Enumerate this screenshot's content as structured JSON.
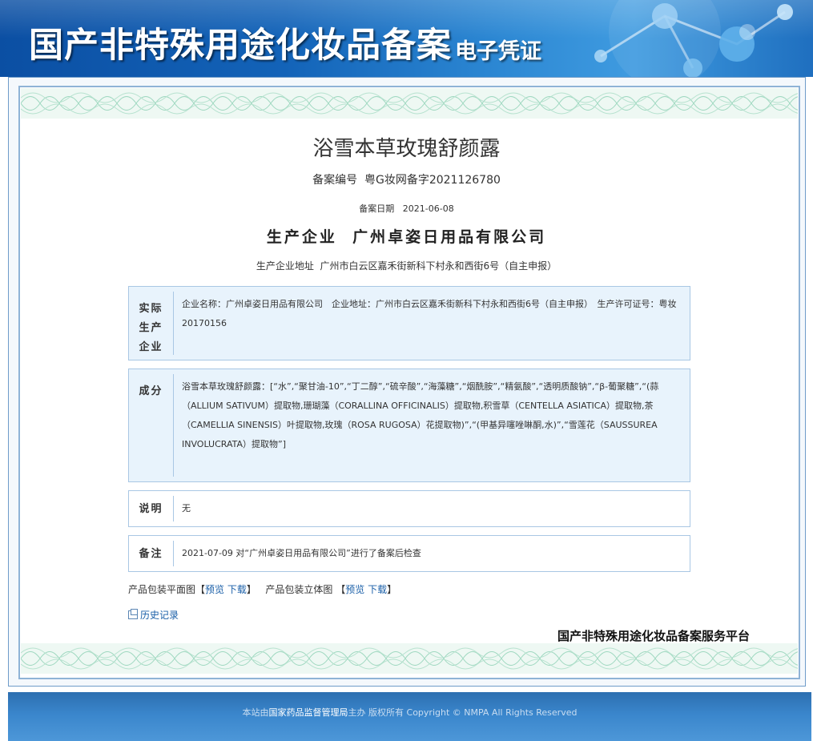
{
  "header": {
    "title": "国产非特殊用途化妆品备案",
    "subtitle": "电子凭证"
  },
  "certificate": {
    "product_name": "浴雪本草玫瑰舒颜露",
    "filing_no_label": "备案编号",
    "filing_no": "粤G妆网备字2021126780",
    "filing_date_label": "备案日期",
    "filing_date": "2021-06-08",
    "producer_label": "生产企业",
    "producer": "广州卓姿日用品有限公司",
    "producer_addr_label": "生产企业地址",
    "producer_addr": "广州市白云区嘉禾街新科下村永和西街6号（自主申报）"
  },
  "sections": {
    "actual_producer": {
      "label_lines": [
        "实际",
        "生产",
        "企业"
      ],
      "content": "企业名称：广州卓姿日用品有限公司　企业地址：广州市白云区嘉禾街新科下村永和西街6号（自主申报）　生产许可证号：粤妆20170156"
    },
    "ingredients": {
      "label": "成分",
      "content": "浴雪本草玫瑰舒颜露：[“水”,“聚甘油-10”,“丁二醇”,“硫辛酸”,“海藻糖”,“烟酰胺”,“精氨酸”,“透明质酸钠”,“β-葡聚糖”,“(蒜（ALLIUM SATIVUM）提取物,珊瑚藻（CORALLINA OFFICINALIS）提取物,积雪草（CENTELLA ASIATICA）提取物,茶（CAMELLIA SINENSIS）叶提取物,玫瑰（ROSA RUGOSA）花提取物)”,“(甲基异噻唑啉酮,水)”,“雪莲花（SAUSSUREA INVOLUCRATA）提取物”]"
    },
    "note": {
      "label": "说明",
      "content": "无"
    },
    "remark": {
      "label": "备注",
      "content": "2021-07-09 对“广州卓姿日用品有限公司”进行了备案后检查"
    }
  },
  "packaging": {
    "flat_label": "产品包装平面图",
    "solid_label": "产品包装立体图",
    "preview": "预览",
    "download": "下载",
    "bracket_open": "【",
    "bracket_close": "】"
  },
  "history_label": "历史记录",
  "platform_label": "国产非特殊用途化妆品备案服务平台",
  "footer": {
    "prefix": "本站由",
    "org": "国家药品监督管理局",
    "suffix": "主办 版权所有 Copyright © NMPA All Rights Reserved"
  },
  "colors": {
    "banner_blue": "#1363b8",
    "box_blue": "#e8f3fc",
    "link_blue": "#1a5fa8",
    "footer_blue": "#3a86cc"
  }
}
